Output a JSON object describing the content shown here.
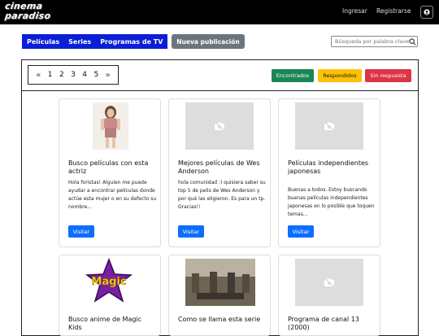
{
  "header": {
    "logo_line1": "cinema",
    "logo_line2": "paradiso",
    "login": "Ingresar",
    "register": "Registrarse",
    "user_icon": "user-circle-icon"
  },
  "nav": {
    "items": [
      "Películas",
      "Series",
      "Programas de TV"
    ],
    "new_post": "Nueva publicación",
    "search_placeholder": "Búsqueda por palabra clave"
  },
  "pagination": {
    "prev": "«",
    "next": "»",
    "pages": [
      "1",
      "2",
      "3",
      "4",
      "5"
    ]
  },
  "filters": [
    {
      "label": "Encontrados",
      "color": "#198754"
    },
    {
      "label": "Respondidos",
      "color": "#ffc107"
    },
    {
      "label": "Sin respuesta",
      "color": "#dc3545"
    }
  ],
  "cards": [
    {
      "title": "Busco películas con esta actriz",
      "text": "Hola foristas! Alguien me puede ayudar a encontrar películas donde actúe esta mujer o en su defecto su nombre...",
      "button": "Visitar"
    },
    {
      "title": "Mejores películas de Wes Anderson",
      "text": "hola comunidad :) quisiera saber su top 5 de pelis de Wes Anderson y por qué las eligieron. Es para un tp. Gracias!!",
      "button": "Visitar"
    },
    {
      "title": "Películas independientes japonesas",
      "text": "Buenas a todos. Estoy buscando buenas películas independientes japonesas en lo posible que toquen temas...",
      "button": "Visitar"
    },
    {
      "title": "Busco anime de Magic Kids",
      "text": "",
      "button": ""
    },
    {
      "title": "Como se llama esta serie",
      "text": "",
      "button": ""
    },
    {
      "title": "Programa de canal 13 (2000)",
      "text": "",
      "button": ""
    }
  ],
  "magic_logo_text": "Magic"
}
